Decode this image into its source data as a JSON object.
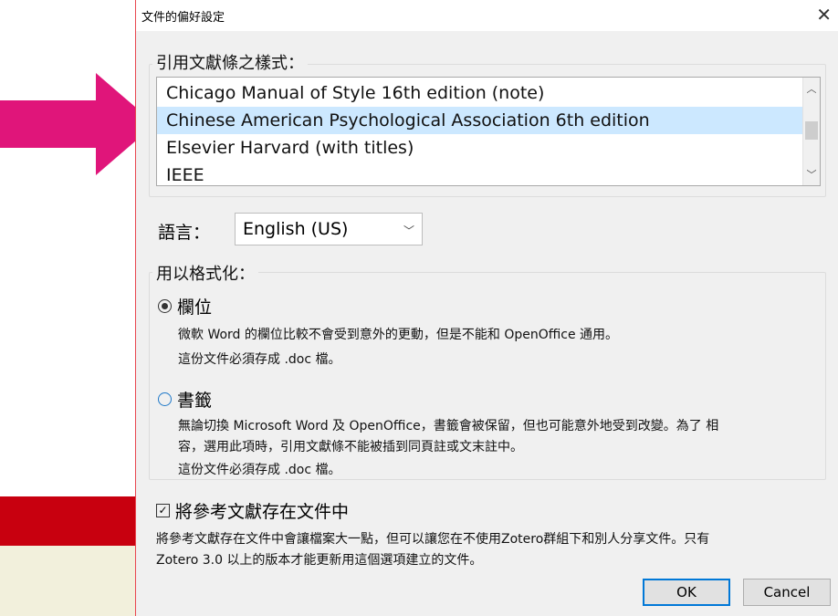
{
  "dialog": {
    "title": "文件的偏好設定",
    "close_glyph": "✕",
    "styles_group": {
      "legend": "引用文獻條之樣式：",
      "items": [
        "Chicago Manual of Style 16th edition (note)",
        "Chinese American Psychological Association 6th edition",
        "Elsevier Harvard (with titles)",
        "IEEE"
      ],
      "selected_index": 1
    },
    "language": {
      "label": "語言：",
      "value": "English (US)"
    },
    "format_group": {
      "legend": "用以格式化：",
      "fields": {
        "label": "欄位",
        "selected": true,
        "desc1": "微軟 Word 的欄位比較不會受到意外的更動，但是不能和 OpenOffice 通用。",
        "desc2": "這份文件必須存成 .doc 檔。"
      },
      "bookmarks": {
        "label": "書籤",
        "selected": false,
        "desc1": "無論切換 Microsoft Word 及 OpenOffice，書籤會被保留，但也可能意外地受到改變。為了 相",
        "desc2": "容，選用此項時，引用文獻條不能被插到同頁註或文末註中。",
        "desc3": "這份文件必須存成 .doc 檔。"
      }
    },
    "store_refs": {
      "label": "將參考文獻存在文件中",
      "checked": true,
      "desc1": "將參考文獻存在文件中會讓檔案大一點，但可以讓您在不使用Zotero群組下和別人分享文件。只有",
      "desc2": "Zotero 3.0 以上的版本才能更新用這個選項建立的文件。"
    },
    "buttons": {
      "ok": "OK",
      "cancel": "Cancel"
    }
  },
  "colors": {
    "arrow": "#e0157a",
    "selection": "#cce8ff",
    "background_red": "#c8000f",
    "background_cream": "#f2f0dc"
  }
}
